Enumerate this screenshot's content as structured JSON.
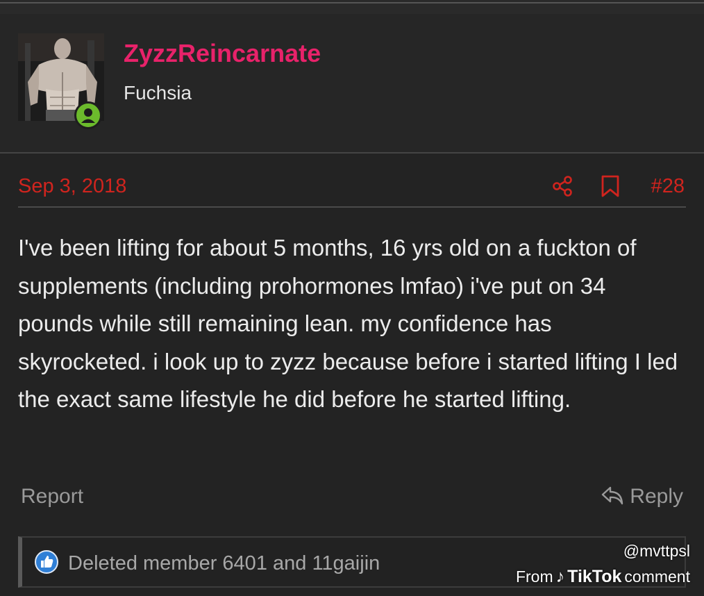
{
  "post": {
    "username": "ZyzzReincarnate",
    "user_title": "Fuchsia",
    "date": "Sep 3, 2018",
    "post_number": "#28",
    "body": "I've been lifting for about 5 months, 16 yrs old on a fuckton of supplements (including prohormones lmfao) i've put on 34 pounds while still remaining lean. my confidence has skyrocketed. i look up to zyzz because before i started lifting I led the exact same lifestyle he did before he started lifting.",
    "report_label": "Report",
    "reply_label": "Reply",
    "reactions_text": "Deleted member 6401 and 11gaijin"
  },
  "watermark": {
    "handle": "@mvttpsl",
    "from": "From",
    "brand_glyph": "♪",
    "brand": "TikTok",
    "suffix": "comment"
  },
  "colors": {
    "username": "#e8226a",
    "meta_red": "#d0241e",
    "online": "#6cbb2c",
    "like": "#2f7fd6"
  },
  "icons": [
    "avatar-photo",
    "online-status-icon",
    "share-icon",
    "bookmark-icon",
    "reply-icon",
    "like-reaction-icon",
    "tiktok-logo-icon"
  ]
}
